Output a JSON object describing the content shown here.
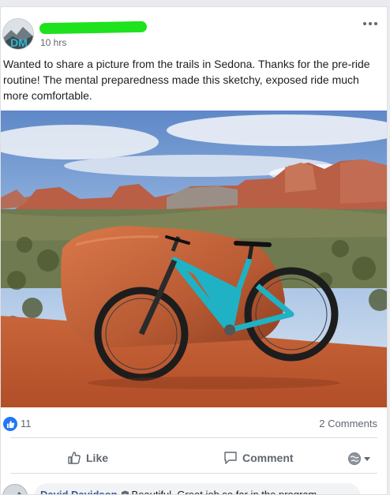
{
  "post": {
    "author_name": "",
    "timestamp": "10 hrs",
    "text": "Wanted to share a picture from the trails in Sedona. Thanks for the pre-ride routine! The mental preparedness made this sketchy, exposed ride much more comfortable.",
    "avatar_text": "DM",
    "photo_subject": "mountain-bike-sedona-trail"
  },
  "reactions": {
    "icon": "like-thumb-icon",
    "count": "11",
    "comments_label": "2 Comments"
  },
  "actions": {
    "like_label": "Like",
    "comment_label": "Comment"
  },
  "comment_preview": {
    "author": "David Davidson",
    "text": "Beautiful. Great job so far in the program,"
  },
  "colors": {
    "accent": "#2078f4",
    "link": "#385898",
    "redaction": "#1de21d",
    "bike_frame": "#1fb2c4"
  }
}
